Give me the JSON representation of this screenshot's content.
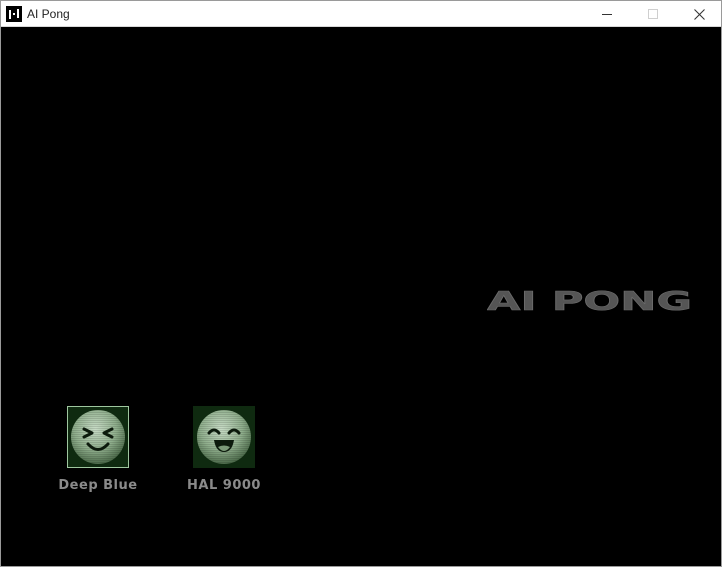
{
  "window": {
    "title": "AI Pong",
    "controls": {
      "minimize_icon": "minimize-icon",
      "maximize_icon": "maximize-icon",
      "close_icon": "close-icon"
    }
  },
  "game": {
    "title": "AI PONG",
    "title_color": "#5a5a5a",
    "background": "#000000",
    "players": [
      {
        "name": "Deep Blue",
        "avatar": "squinting-face-icon",
        "selected": true
      },
      {
        "name": "HAL 9000",
        "avatar": "smiling-face-icon",
        "selected": false
      }
    ]
  }
}
